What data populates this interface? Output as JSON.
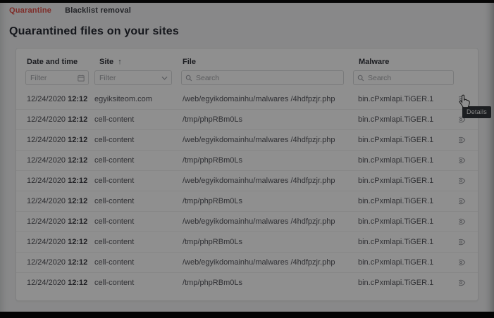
{
  "tabs": [
    {
      "label": "Quarantine",
      "active": true
    },
    {
      "label": "Blacklist removal",
      "active": false
    }
  ],
  "page_title": "Quarantined files on your sites",
  "table": {
    "columns": [
      {
        "label": "Date and time",
        "filter_placeholder": "Filter",
        "filter_icon": "calendar-icon"
      },
      {
        "label": "Site",
        "sort_indicator": "↑",
        "filter_placeholder": "Filter",
        "filter_icon": "chevron-down-icon"
      },
      {
        "label": "File",
        "filter_placeholder": "Search",
        "filter_icon": "search-icon"
      },
      {
        "label": "Malware",
        "filter_placeholder": "Search",
        "filter_icon": "search-icon"
      }
    ],
    "row_action_icon": "eye-icon",
    "rows": [
      {
        "date": "12/24/2020",
        "time": "12:12",
        "site": "egyiksiteom.com",
        "file": "/web/egyikdomainhu/malwares /4hdfpzjr.php",
        "malware": "bin.cPxmlapi.TiGER.1"
      },
      {
        "date": "12/24/2020",
        "time": "12:12",
        "site": "cell-content",
        "file": "/tmp/phpRBm0Ls",
        "malware": "bin.cPxmlapi.TiGER.1"
      },
      {
        "date": "12/24/2020",
        "time": "12:12",
        "site": "cell-content",
        "file": "/web/egyikdomainhu/malwares /4hdfpzjr.php",
        "malware": "bin.cPxmlapi.TiGER.1"
      },
      {
        "date": "12/24/2020",
        "time": "12:12",
        "site": "cell-content",
        "file": "/tmp/phpRBm0Ls",
        "malware": "bin.cPxmlapi.TiGER.1"
      },
      {
        "date": "12/24/2020",
        "time": "12:12",
        "site": "cell-content",
        "file": "/web/egyikdomainhu/malwares /4hdfpzjr.php",
        "malware": "bin.cPxmlapi.TiGER.1"
      },
      {
        "date": "12/24/2020",
        "time": "12:12",
        "site": "cell-content",
        "file": "/tmp/phpRBm0Ls",
        "malware": "bin.cPxmlapi.TiGER.1"
      },
      {
        "date": "12/24/2020",
        "time": "12:12",
        "site": "cell-content",
        "file": "/web/egyikdomainhu/malwares /4hdfpzjr.php",
        "malware": "bin.cPxmlapi.TiGER.1"
      },
      {
        "date": "12/24/2020",
        "time": "12:12",
        "site": "cell-content",
        "file": "/tmp/phpRBm0Ls",
        "malware": "bin.cPxmlapi.TiGER.1"
      },
      {
        "date": "12/24/2020",
        "time": "12:12",
        "site": "cell-content",
        "file": "/web/egyikdomainhu/malwares /4hdfpzjr.php",
        "malware": "bin.cPxmlapi.TiGER.1"
      },
      {
        "date": "12/24/2020",
        "time": "12:12",
        "site": "cell-content",
        "file": "/tmp/phpRBm0Ls",
        "malware": "bin.cPxmlapi.TiGER.1"
      }
    ]
  },
  "tooltip": {
    "label": "Details"
  },
  "colors": {
    "accent_red": "#e2504a",
    "tooltip_bg": "#33373b",
    "icon_gray": "#9fa1a8"
  }
}
